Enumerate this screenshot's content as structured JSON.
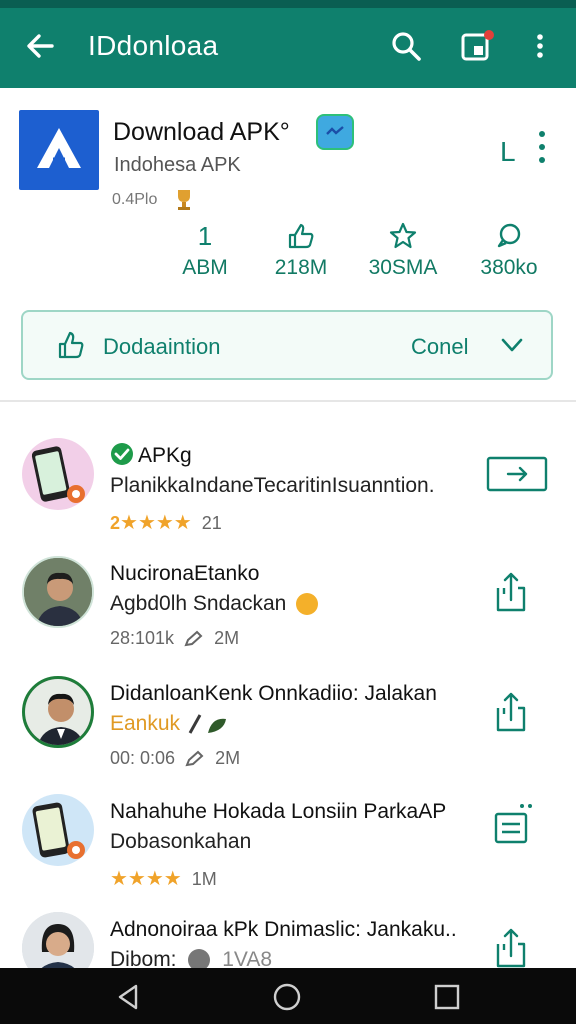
{
  "appbar": {
    "title": "IDdonloaa",
    "icons": [
      "back-arrow-icon",
      "search-icon",
      "notification-box-icon",
      "more-vert-icon"
    ]
  },
  "app": {
    "name": "Download APK°",
    "publisher": "Indohesa APK",
    "version": "0.4Plo",
    "side_button": "L"
  },
  "stats": [
    {
      "icon": "number",
      "icon_text": "1",
      "value": "ABM"
    },
    {
      "icon": "thumb-icon",
      "value": "218M"
    },
    {
      "icon": "star-icon",
      "value": "30SMA"
    },
    {
      "icon": "chat-icon",
      "value": "380ko"
    }
  ],
  "action_bar": {
    "primary_label": "Dodaaintion",
    "secondary_label": "Conel"
  },
  "items": [
    {
      "name": "APKg",
      "sub": "PlanikkaIndaneTecaritinIsuanntion.",
      "rating_prefix": "2",
      "stars": "★★★★",
      "rating_count": "21",
      "action": "arrow-button"
    },
    {
      "name": "NucironaEtanko",
      "sub": "Agbd0lh Sndackan",
      "meta_size": "28:101k",
      "meta_count": "2M",
      "action": "share"
    },
    {
      "name": "DidanloanKenk Onnkadiio: Jalakan",
      "sub": "Eankuk",
      "meta_size": "00: 0:06",
      "meta_count": "2M",
      "action": "share"
    },
    {
      "name": "Nahahuhe Hokada Lonsiin ParkaAP",
      "sub": "Dobasonkahan",
      "stars": "★★★★",
      "meta_count": "1M",
      "action": "list"
    },
    {
      "name": "Adnonoiraa kPk Dnimaslic: Jankaku..",
      "sub": "Dibom:",
      "meta_count": "1VA8",
      "action": "share"
    }
  ],
  "colors": {
    "appbar": "#0f806d",
    "accent": "#0f806d",
    "star": "#f0a32a",
    "app_icon": "#1d5fd0"
  }
}
